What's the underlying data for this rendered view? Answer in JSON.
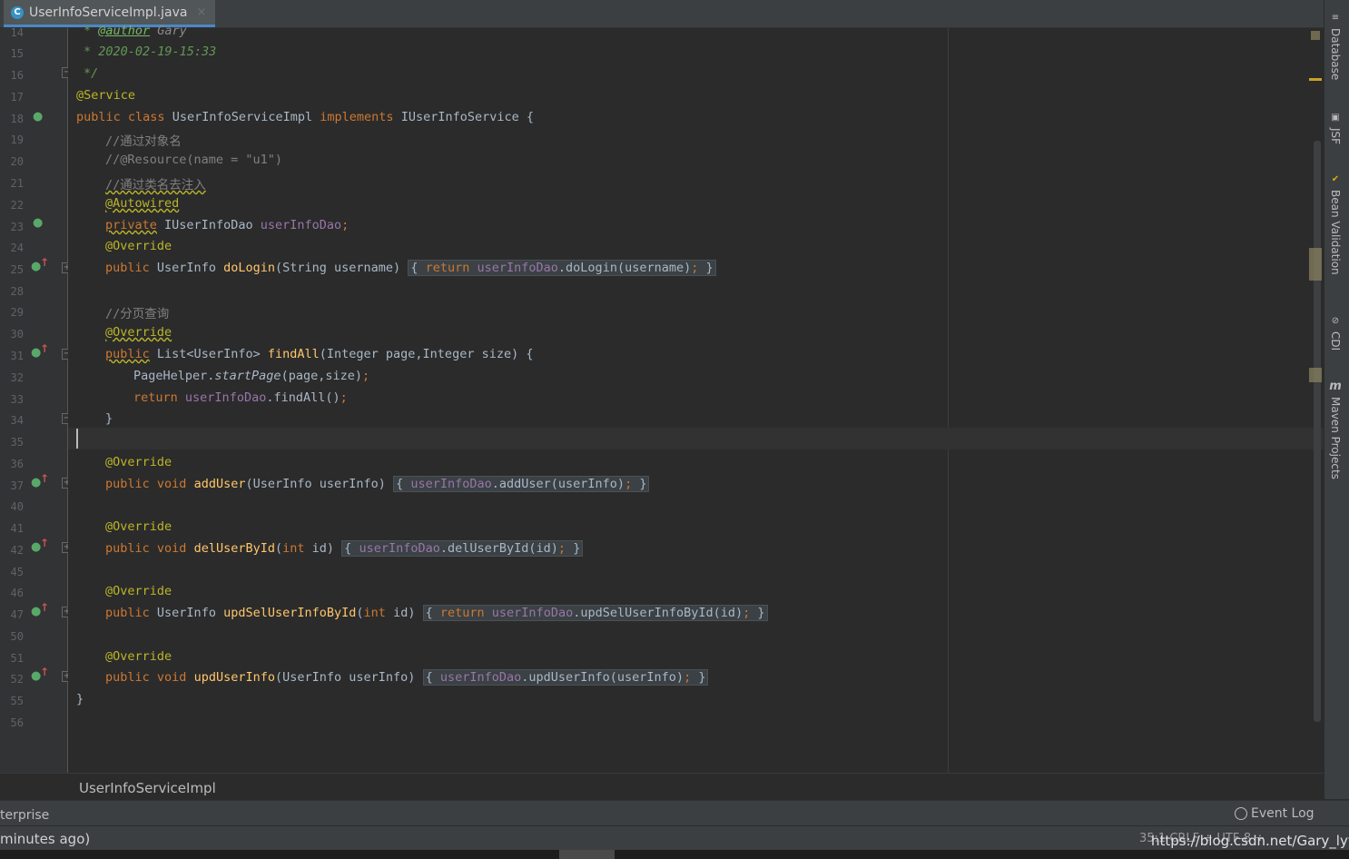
{
  "tab": {
    "title": "UserInfoServiceImpl.java",
    "icon": "C",
    "close": "×"
  },
  "lines": [
    {
      "num": "14",
      "code": "comment_author"
    },
    {
      "num": "15"
    },
    {
      "num": "16"
    },
    {
      "num": "17"
    },
    {
      "num": "18"
    },
    {
      "num": "19"
    },
    {
      "num": "20"
    },
    {
      "num": "21"
    },
    {
      "num": "22"
    },
    {
      "num": "23"
    },
    {
      "num": "24"
    },
    {
      "num": "25"
    },
    {
      "num": "28"
    },
    {
      "num": "29"
    },
    {
      "num": "30"
    },
    {
      "num": "31"
    },
    {
      "num": "32"
    },
    {
      "num": "33"
    },
    {
      "num": "34"
    },
    {
      "num": "35"
    },
    {
      "num": "36"
    },
    {
      "num": "37"
    },
    {
      "num": "40"
    },
    {
      "num": "41"
    },
    {
      "num": "42"
    },
    {
      "num": "45"
    },
    {
      "num": "46"
    },
    {
      "num": "47"
    },
    {
      "num": "50"
    },
    {
      "num": "51"
    },
    {
      "num": "52"
    },
    {
      "num": "55"
    },
    {
      "num": "56"
    }
  ],
  "code": {
    "doc_star": "* ",
    "author_tag": "@author",
    "author_name": " Gary",
    "date": "* 2020-02-19-15:33",
    "doc_end": "*/",
    "service": "@Service",
    "kw_public": "public",
    "kw_class": "class",
    "class_name": "UserInfoServiceImpl",
    "kw_implements": "implements",
    "iface": "IUserInfoService",
    "brace_open": " {",
    "c1": "//通过对象名",
    "c2": "//@Resource(name = \"u1\")",
    "c3": "//通过类名去注入",
    "autowired": "@Autowired",
    "kw_private": "private",
    "dao_type": "IUserInfoDao",
    "dao_field": "userInfoDao",
    "semi": ";",
    "override": "@Override",
    "ret_userinfo": "UserInfo",
    "m_dologin": "doLogin",
    "dologin_params": "(String username)",
    "kw_return": "return",
    "dologin_call": ".doLogin(username)",
    "c4": "//分页查询",
    "list_type": "List<UserInfo>",
    "m_findall": "findAll",
    "findall_params": "(Integer page,Integer size)",
    "pagehelper": "PageHelper.",
    "startpage": "startPage",
    "startpage_args": "(page,size)",
    "findall_call": ".findAll()",
    "close_brace": "}",
    "kw_void": "void",
    "m_adduser": "addUser",
    "adduser_params": "(UserInfo userInfo)",
    "adduser_call": ".addUser(userInfo)",
    "m_deluser": "delUserById",
    "kw_int": "int",
    "id_param": " id)",
    "open_paren": "(",
    "deluser_call": ".delUserById(id)",
    "m_updsel": "updSelUserInfoById",
    "updsel_call": ".updSelUserInfoById(id)",
    "m_upduser": "updUserInfo",
    "upduser_call": ".updUserInfo(userInfo)",
    "lbrace": "{",
    "rbrace": "}"
  },
  "right_tools": [
    {
      "label": "Database",
      "icon": "database-icon"
    },
    {
      "label": "JSF",
      "icon": "jsf-icon"
    },
    {
      "label": "Bean Validation",
      "icon": "bean-validation-icon"
    },
    {
      "label": "CDI",
      "icon": "cdi-icon"
    },
    {
      "label": "Maven Projects",
      "icon": "maven-icon"
    }
  ],
  "breadcrumb": "UserInfoServiceImpl",
  "toolwindow_left": "terprise",
  "event_log": "Event Log",
  "status_left": "minutes ago)",
  "status_right": "35:1   CRLF ÷   UTF-8 ÷",
  "watermark": "https://blog.csdn.net/Gary_lyy"
}
